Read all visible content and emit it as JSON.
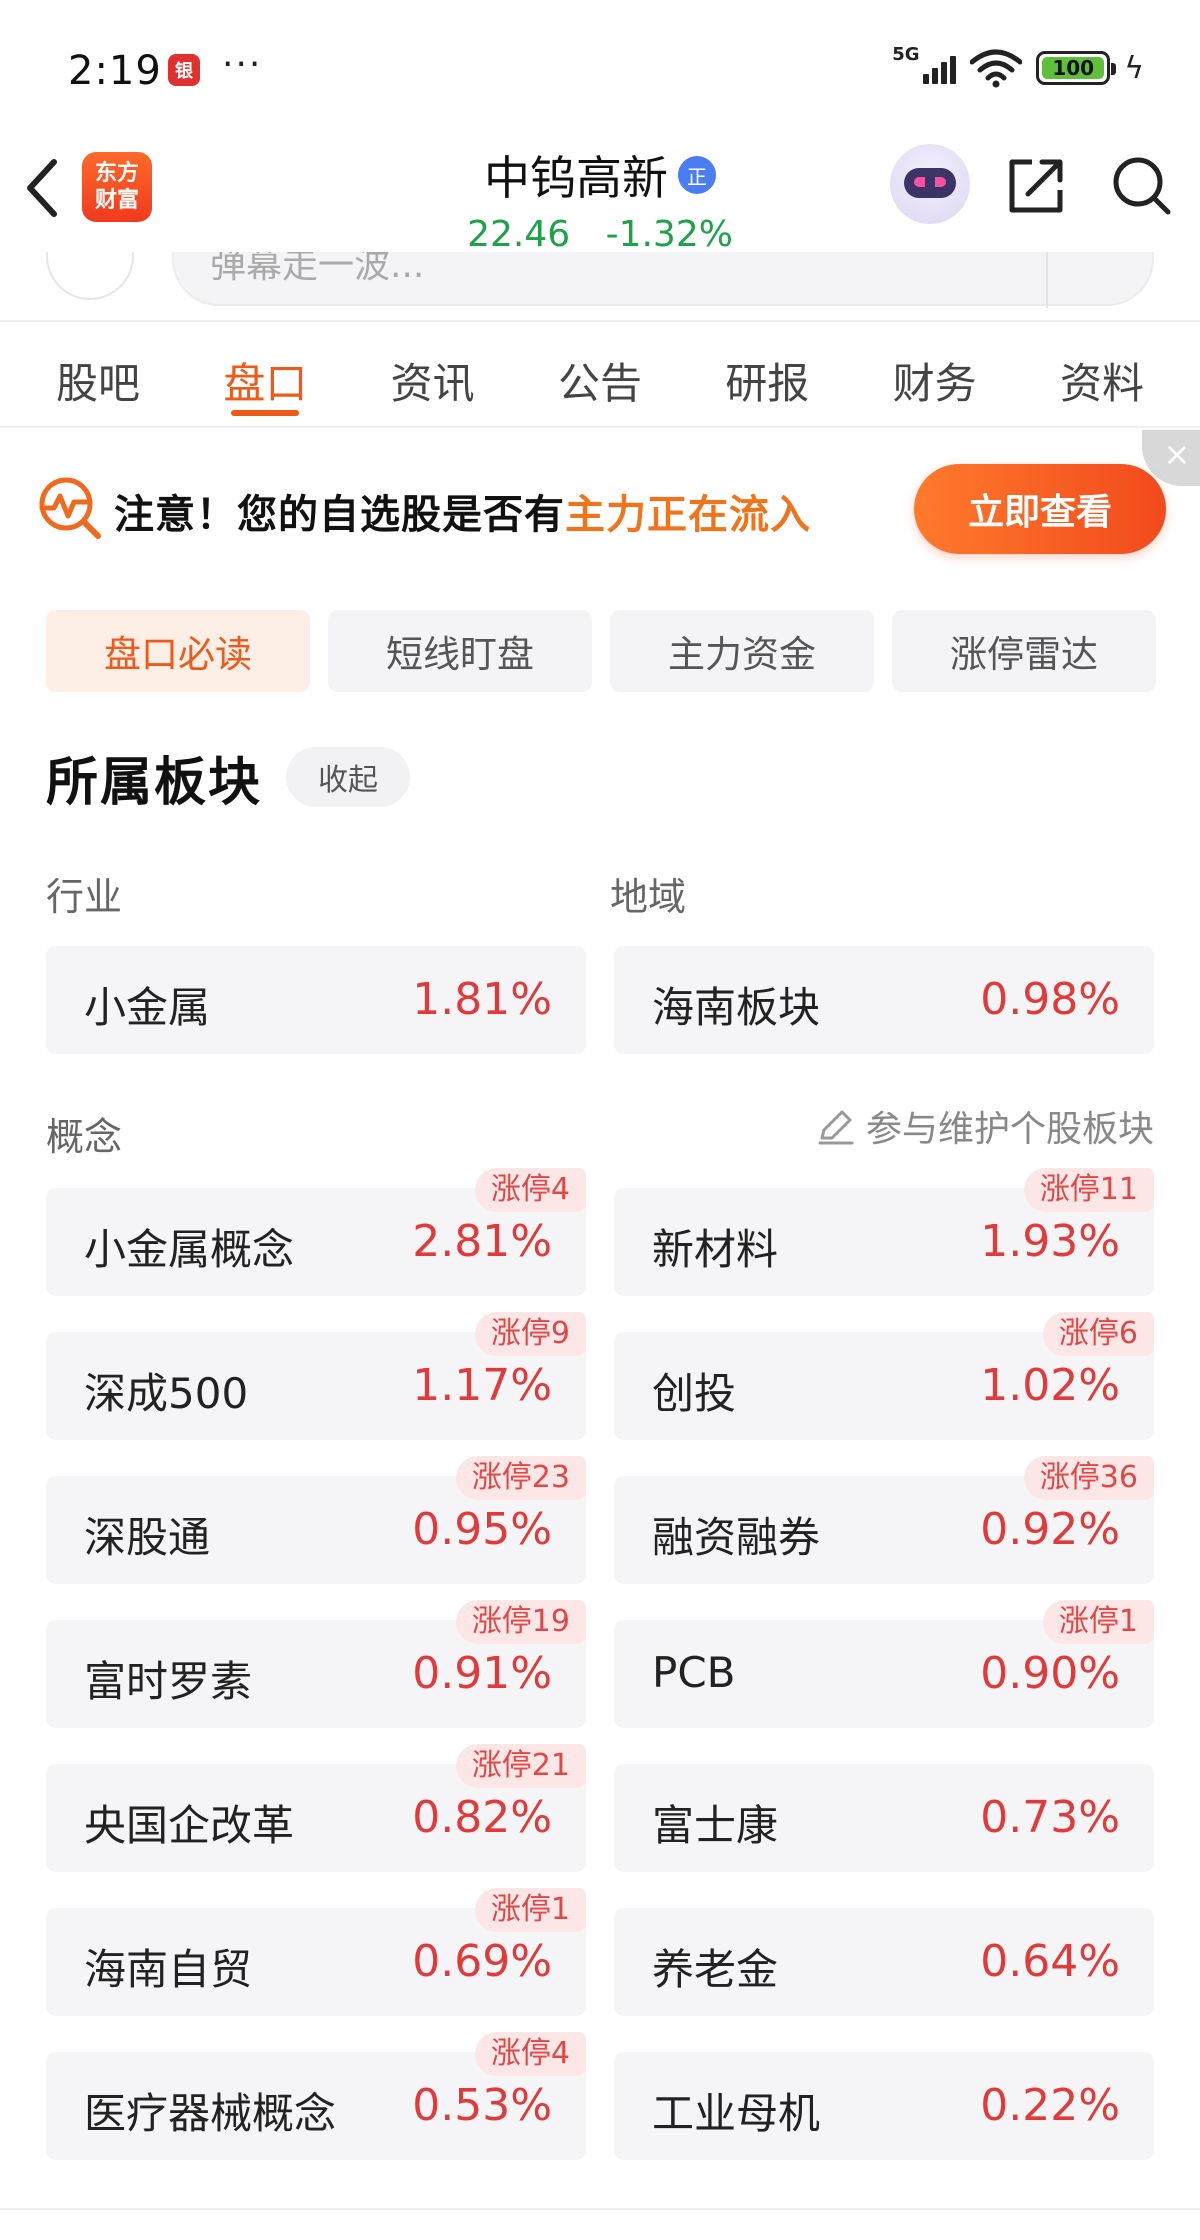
{
  "status_bar": {
    "time": "2:19",
    "app_icon": "银",
    "dots": "···",
    "network": "5G",
    "battery": "100",
    "charging_icon": "bolt-icon"
  },
  "header": {
    "logo_line1": "东方",
    "logo_line2": "财富",
    "stock_name": "中钨高新",
    "badge": "正",
    "price": "22.46",
    "change_pct": "-1.32%",
    "price_color": "#1fa14a"
  },
  "search_strip": {
    "placeholder": "弹幕走一波..."
  },
  "tabs": [
    {
      "label": "股吧",
      "active": false
    },
    {
      "label": "盘口",
      "active": true
    },
    {
      "label": "资讯",
      "active": false
    },
    {
      "label": "公告",
      "active": false
    },
    {
      "label": "研报",
      "active": false
    },
    {
      "label": "财务",
      "active": false
    },
    {
      "label": "资料",
      "active": false
    }
  ],
  "banner": {
    "text_prefix": "注意！您的自选股是否有",
    "text_highlight": "主力正在流入",
    "button": "立即查看",
    "close": "×",
    "highlight_color": "#f0741c"
  },
  "subtabs": [
    {
      "label": "盘口必读",
      "active": true
    },
    {
      "label": "短线盯盘",
      "active": false
    },
    {
      "label": "主力资金",
      "active": false
    },
    {
      "label": "涨停雷达",
      "active": false
    }
  ],
  "section": {
    "title": "所属板块",
    "collapse": "收起",
    "industry_label": "行业",
    "region_label": "地域",
    "concept_label": "概念",
    "maintain_link": "参与维护个股板块"
  },
  "industry": {
    "name": "小金属",
    "pct": "1.81%"
  },
  "region": {
    "name": "海南板块",
    "pct": "0.98%"
  },
  "concepts": [
    {
      "name": "小金属概念",
      "pct": "2.81%",
      "tag": "涨停4"
    },
    {
      "name": "新材料",
      "pct": "1.93%",
      "tag": "涨停11"
    },
    {
      "name": "深成500",
      "pct": "1.17%",
      "tag": "涨停9"
    },
    {
      "name": "创投",
      "pct": "1.02%",
      "tag": "涨停6"
    },
    {
      "name": "深股通",
      "pct": "0.95%",
      "tag": "涨停23"
    },
    {
      "name": "融资融券",
      "pct": "0.92%",
      "tag": "涨停36"
    },
    {
      "name": "富时罗素",
      "pct": "0.91%",
      "tag": "涨停19"
    },
    {
      "name": "PCB",
      "pct": "0.90%",
      "tag": "涨停1"
    },
    {
      "name": "央国企改革",
      "pct": "0.82%",
      "tag": "涨停21"
    },
    {
      "name": "富士康",
      "pct": "0.73%",
      "tag": ""
    },
    {
      "name": "海南自贸",
      "pct": "0.69%",
      "tag": "涨停1"
    },
    {
      "name": "养老金",
      "pct": "0.64%",
      "tag": ""
    },
    {
      "name": "医疗器械概念",
      "pct": "0.53%",
      "tag": "涨停4"
    },
    {
      "name": "工业母机",
      "pct": "0.22%",
      "tag": ""
    }
  ]
}
